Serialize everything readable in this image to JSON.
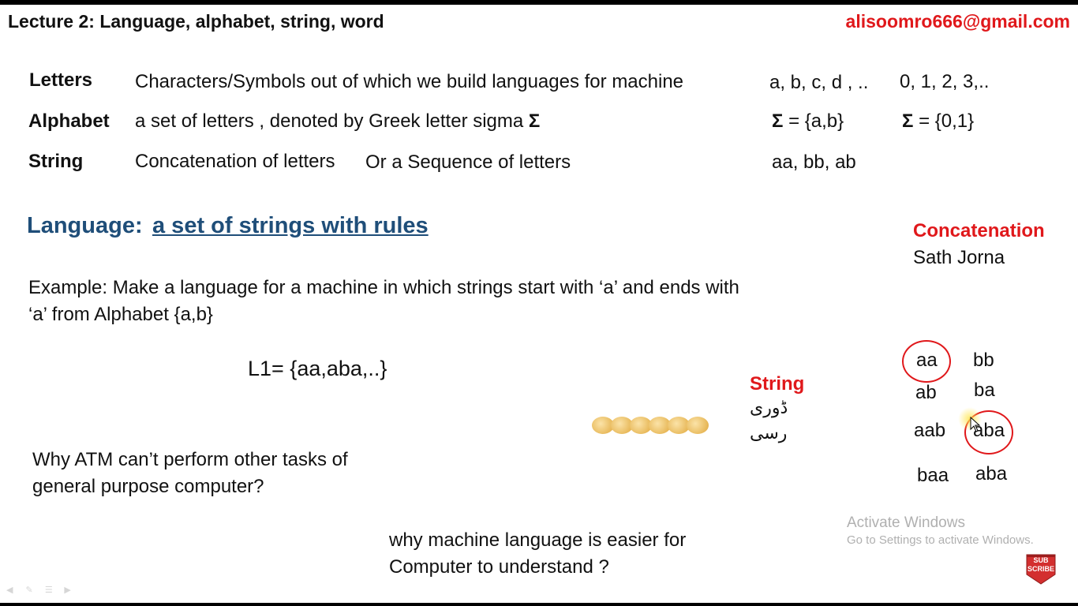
{
  "header": {
    "title": "Lecture 2: Language, alphabet, string, word",
    "email": "alisoomro666@gmail.com"
  },
  "definitions": {
    "letters": {
      "term": "Letters",
      "definition": "Characters/Symbols out of which we build languages for machine",
      "example1": "a, b, c, d , ..",
      "example2": "0, 1, 2, 3,.."
    },
    "alphabet": {
      "term": "Alphabet",
      "definition": "a set of letters , denoted by Greek letter sigma ",
      "sigma": "Σ",
      "example1_sigma": "Σ",
      "example1_rest": " = {a,b}",
      "example2_sigma": "Σ",
      "example2_rest": " = {0,1}"
    },
    "string": {
      "term": "String",
      "definition1": "Concatenation of letters",
      "definition2": "Or a Sequence of letters",
      "example": "aa, bb, ab"
    }
  },
  "language": {
    "label": "Language:",
    "definition": "a set of strings with rules"
  },
  "concatenation": {
    "heading": "Concatenation",
    "translation": "Sath Jorna"
  },
  "example": {
    "text": "Example: Make a language for a machine in which strings start with ‘a’ and ends with ‘a’ from Alphabet {a,b}",
    "set": "L1= {aa,aba,..}"
  },
  "string_note": {
    "heading": "String",
    "urdu1": "ڈوری",
    "urdu2": "رسی"
  },
  "words": {
    "w1": "aa",
    "w2": "bb",
    "w3": "ab",
    "w4": "ba",
    "w5": "aab",
    "w6": "aba",
    "w7": "baa",
    "w8": "aba"
  },
  "questions": {
    "q1": "Why ATM can’t perform other tasks of general purpose computer?",
    "q2": "why machine language is easier for Computer to understand ?"
  },
  "watermark": {
    "line1": "Activate Windows",
    "line2": "Go to Settings to activate Windows."
  },
  "subscribe": {
    "line1": "SUB",
    "line2": "SCRIBE"
  },
  "colors": {
    "accent_red": "#e0181b",
    "heading_blue": "#1f4e79"
  }
}
